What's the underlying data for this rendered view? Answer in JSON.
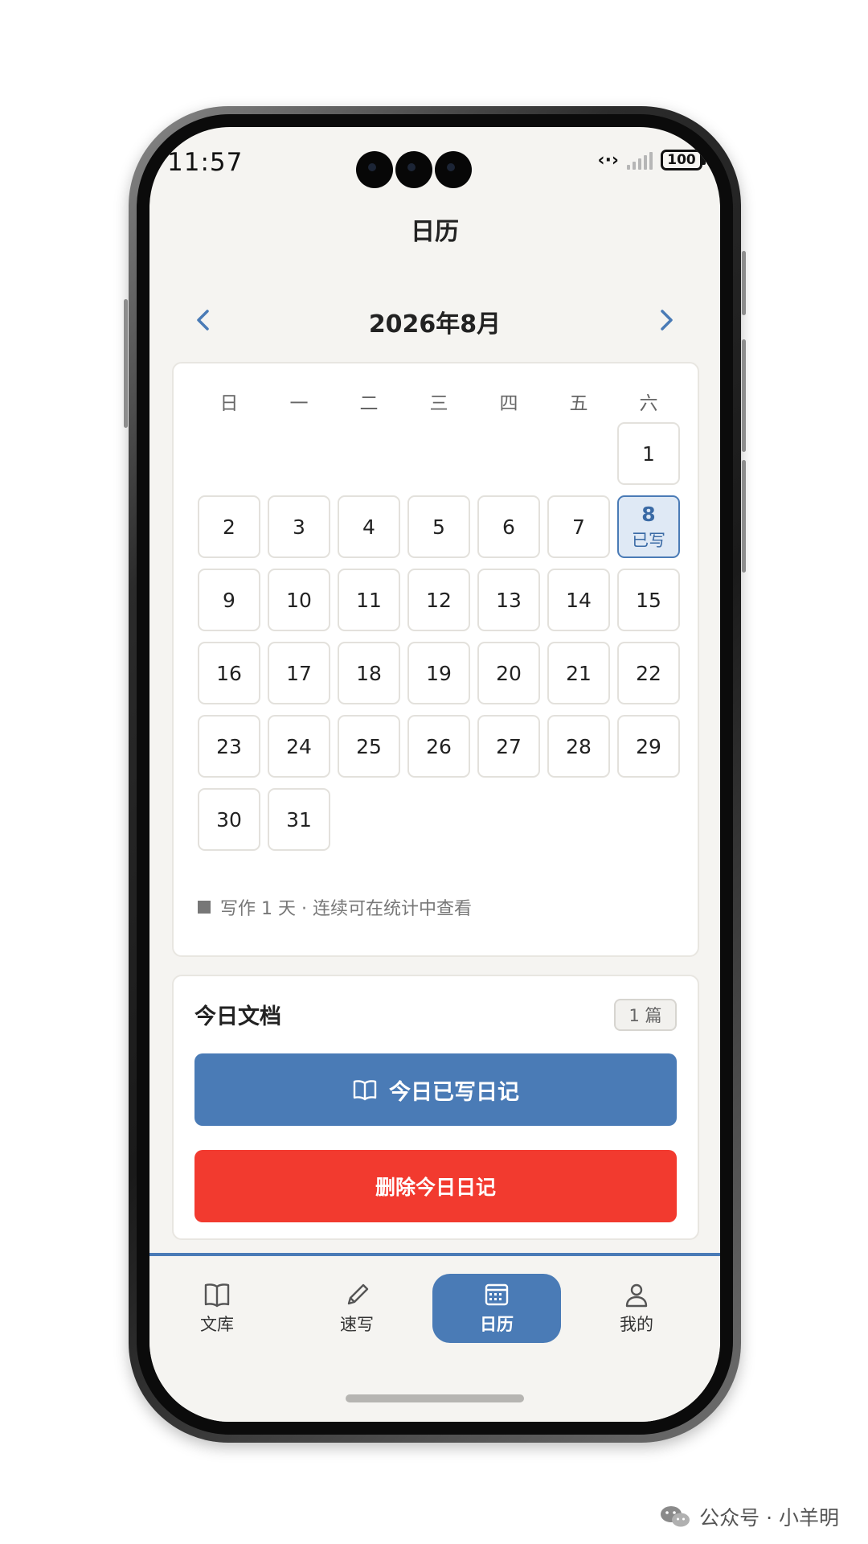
{
  "status_bar": {
    "time": "11:57",
    "battery": "100",
    "icons": [
      "network-icon",
      "signal-icon",
      "battery-icon"
    ]
  },
  "page": {
    "title": "日历"
  },
  "calendar": {
    "month_label": "2026年8月",
    "weekdays": [
      "日",
      "一",
      "二",
      "三",
      "四",
      "五",
      "六"
    ],
    "days": [
      "1",
      "2",
      "3",
      "4",
      "5",
      "6",
      "7",
      "8",
      "9",
      "10",
      "11",
      "12",
      "13",
      "14",
      "15",
      "16",
      "17",
      "18",
      "19",
      "20",
      "21",
      "22",
      "23",
      "24",
      "25",
      "26",
      "27",
      "28",
      "29",
      "30",
      "31"
    ],
    "selected_day": "8",
    "selected_day_note": "已写",
    "legend": "写作 1 天 · 连续可在统计中查看"
  },
  "today_docs": {
    "title": "今日文档",
    "count": "1 篇",
    "primary_button": "今日已写日记",
    "delete_button": "删除今日日记"
  },
  "bottom_nav": {
    "items": [
      {
        "label": "文库",
        "icon": "book-icon"
      },
      {
        "label": "速写",
        "icon": "pencil-icon"
      },
      {
        "label": "日历",
        "icon": "calendar-icon",
        "active": true
      },
      {
        "label": "我的",
        "icon": "user-icon"
      }
    ]
  },
  "watermark": {
    "text": "公众号 · 小羊明"
  },
  "colors": {
    "accent": "#4a7bb6",
    "danger": "#f23a2f",
    "background": "#f5f4f1"
  }
}
